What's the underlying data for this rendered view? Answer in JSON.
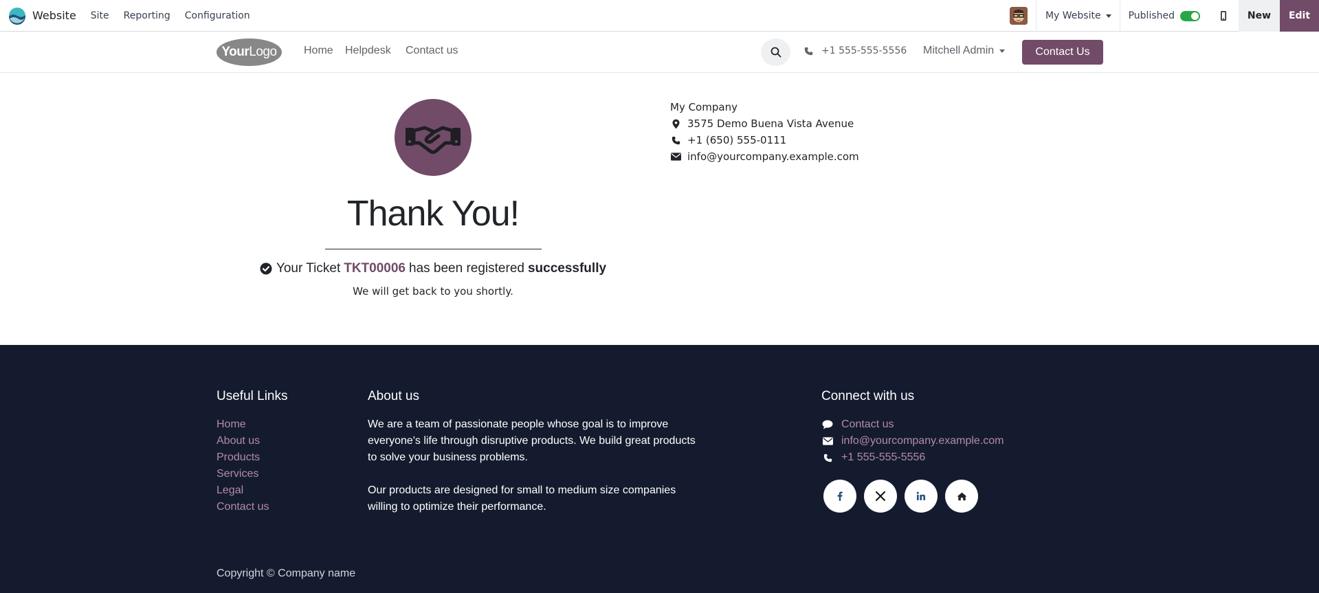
{
  "topbar": {
    "app_name": "Website",
    "menus": [
      "Site",
      "Reporting",
      "Configuration"
    ],
    "website_selector": "My Website",
    "published_label": "Published",
    "published": true,
    "new_label": "New",
    "edit_label": "Edit"
  },
  "header": {
    "logo_text_bold": "Your",
    "logo_text_light": "Logo",
    "nav": [
      "Home",
      "Helpdesk",
      "Contact us"
    ],
    "phone": "+1 555-555-5556",
    "user": "Mitchell Admin",
    "cta": "Contact Us"
  },
  "main": {
    "thank_you": "Thank You!",
    "ticket_prefix": "Your Ticket",
    "ticket_id": "TKT00006",
    "ticket_middle": "has been registered",
    "ticket_suffix": "successfully",
    "follow_up": "We will get back to you shortly."
  },
  "company": {
    "name": "My Company",
    "address": "3575 Demo Buena Vista Avenue",
    "phone": "+1 (650) 555-0111",
    "email": "info@yourcompany.example.com"
  },
  "footer": {
    "useful_links_title": "Useful Links",
    "useful_links": [
      "Home",
      "About us",
      "Products",
      "Services",
      "Legal",
      "Contact us"
    ],
    "about_title": "About us",
    "about_p1_lines": [
      "We are a team of passionate people whose goal is to improve",
      "everyone's life through disruptive products. We build great products",
      "to solve your business problems."
    ],
    "about_p2_lines": [
      "Our products are designed for small to medium size companies",
      "willing to optimize their performance."
    ],
    "connect_title": "Connect with us",
    "connect_contact": "Contact us",
    "connect_email": "info@yourcompany.example.com",
    "connect_phone": "+1 555-555-5556",
    "social": [
      "facebook-icon",
      "x-icon",
      "linkedin-icon",
      "home-icon"
    ],
    "copyright": "Copyright © Company name"
  },
  "colors": {
    "brand": "#714b67",
    "footer_bg": "#141b2e",
    "footer_link": "#b48ba7",
    "toggle_on": "#28a745"
  }
}
